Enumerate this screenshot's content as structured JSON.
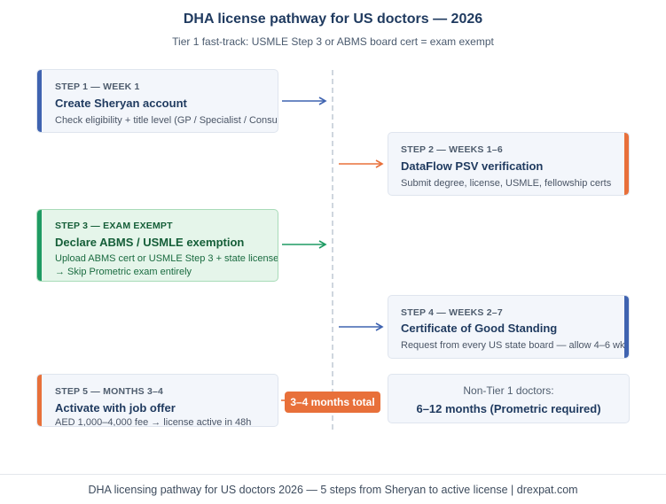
{
  "title": "DHA license pathway for US doctors — 2026",
  "subtitle": "Tier 1 fast-track: USMLE Step 3 or ABMS board cert = exam exempt",
  "colors": {
    "blue": "#3f63b0",
    "orange": "#e8703a",
    "green": "#1e9b63"
  },
  "steps": [
    {
      "label": "STEP 1 — WEEK 1",
      "title": "Create Sheryan account",
      "desc": "Check eligibility + title level (GP / Specialist / Consultant)",
      "desc2": ""
    },
    {
      "label": "STEP 2 — WEEKS 1–6",
      "title": "DataFlow PSV verification",
      "desc": "Submit degree, license, USMLE, fellowship certs",
      "desc2": ""
    },
    {
      "label": "STEP 3 — EXAM EXEMPT",
      "title": "Declare ABMS / USMLE exemption",
      "desc": "Upload ABMS cert or USMLE Step 3 + state license",
      "desc2": "→ Skip Prometric exam entirely"
    },
    {
      "label": "STEP 4 — WEEKS 2–7",
      "title": "Certificate of Good Standing",
      "desc": "Request from every US state board — allow 4–6 wk",
      "desc2": ""
    },
    {
      "label": "STEP 5 — MONTHS 3–4",
      "title": "Activate with job offer",
      "desc": "AED 1,000–4,000 fee → license active in 48h",
      "desc2": ""
    }
  ],
  "total_badge": "3–4 months total",
  "non_tier": {
    "line1": "Non-Tier 1 doctors:",
    "line2": "6–12 months (Prometric required)"
  },
  "footer": "DHA licensing pathway for US doctors 2026 — 5 steps from Sheryan to active license | drexpat.com"
}
